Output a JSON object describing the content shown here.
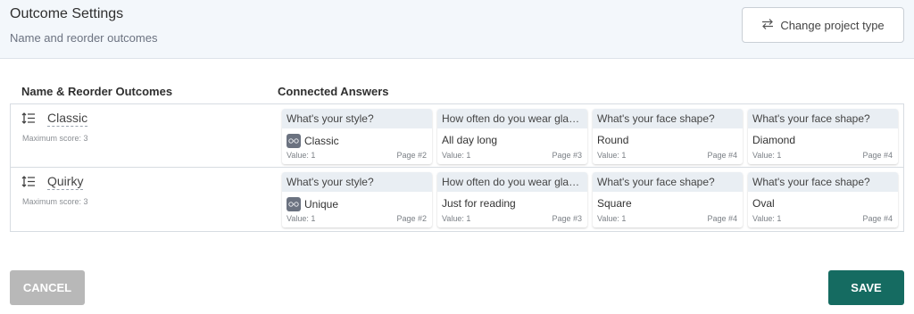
{
  "header": {
    "title": "Outcome Settings",
    "subtitle": "Name and reorder outcomes",
    "change_button": "Change project type"
  },
  "columns": {
    "left": "Name & Reorder Outcomes",
    "right": "Connected Answers"
  },
  "outcomes": [
    {
      "name": "Classic",
      "max_score": "Maximum score: 3",
      "answers": [
        {
          "question": "What's your style?",
          "answer": "Classic",
          "has_thumb": true,
          "value": "Value: 1",
          "page": "Page #2"
        },
        {
          "question": "How often do you wear glas...",
          "answer": "All day long",
          "has_thumb": false,
          "value": "Value: 1",
          "page": "Page #3"
        },
        {
          "question": "What's your face shape?",
          "answer": "Round",
          "has_thumb": false,
          "value": "Value: 1",
          "page": "Page #4"
        },
        {
          "question": "What's your face shape?",
          "answer": "Diamond",
          "has_thumb": false,
          "value": "Value: 1",
          "page": "Page #4"
        }
      ]
    },
    {
      "name": "Quirky",
      "max_score": "Maximum score: 3",
      "answers": [
        {
          "question": "What's your style?",
          "answer": "Unique",
          "has_thumb": true,
          "value": "Value: 1",
          "page": "Page #2"
        },
        {
          "question": "How often do you wear glas...",
          "answer": "Just for reading",
          "has_thumb": false,
          "value": "Value: 1",
          "page": "Page #3"
        },
        {
          "question": "What's your face shape?",
          "answer": "Square",
          "has_thumb": false,
          "value": "Value: 1",
          "page": "Page #4"
        },
        {
          "question": "What's your face shape?",
          "answer": "Oval",
          "has_thumb": false,
          "value": "Value: 1",
          "page": "Page #4"
        }
      ]
    }
  ],
  "footer": {
    "cancel": "CANCEL",
    "save": "SAVE"
  },
  "colors": {
    "save": "#156b61",
    "cancel": "#b8b8b8",
    "header_bg": "#f3f7fb"
  }
}
